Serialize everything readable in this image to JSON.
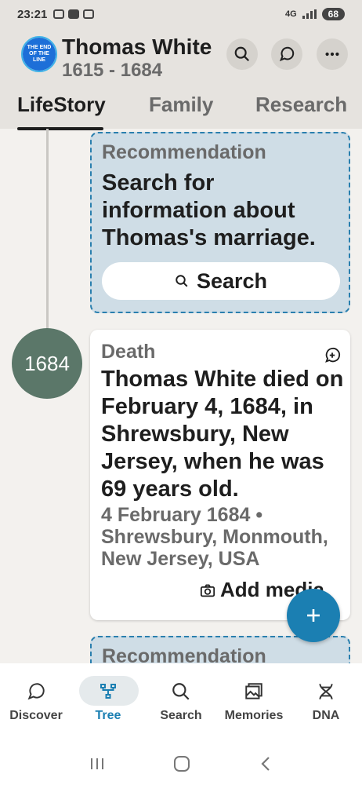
{
  "status_bar": {
    "time": "23:21",
    "network": "4G",
    "battery": "68"
  },
  "header": {
    "logo_text": "THE END OF THE LINE",
    "name": "Thomas White",
    "years": "1615 - 1684",
    "icons": [
      "search-icon",
      "discover-icon",
      "more-icon"
    ]
  },
  "tabs": [
    {
      "label": "LifeStory",
      "active": true
    },
    {
      "label": "Family",
      "active": false
    },
    {
      "label": "Research",
      "active": false
    }
  ],
  "recommendation_1": {
    "label": "Recommendation",
    "text": "Search for information about Thomas's marriage.",
    "button": "Search"
  },
  "event": {
    "year": "1684",
    "type": "Death",
    "description": "Thomas White died on February 4, 1684, in Shrewsbury, New Jersey, when he was 69 years old.",
    "date": "4 February 1684 •",
    "place": "Shrewsbury, Monmouth, New Jersey, USA",
    "add_media": "Add media"
  },
  "recommendation_2": {
    "label": "Recommendation"
  },
  "bottom_nav": [
    {
      "label": "Discover",
      "icon": "discover-icon",
      "active": false
    },
    {
      "label": "Tree",
      "icon": "tree-icon",
      "active": true
    },
    {
      "label": "Search",
      "icon": "search-icon",
      "active": false
    },
    {
      "label": "Memories",
      "icon": "memories-icon",
      "active": false
    },
    {
      "label": "DNA",
      "icon": "dna-icon",
      "active": false
    }
  ],
  "colors": {
    "accent": "#1b7fb2",
    "badge": "#5b7769",
    "rec_bg": "#cfdde6",
    "header_bg": "#e6e3df"
  }
}
